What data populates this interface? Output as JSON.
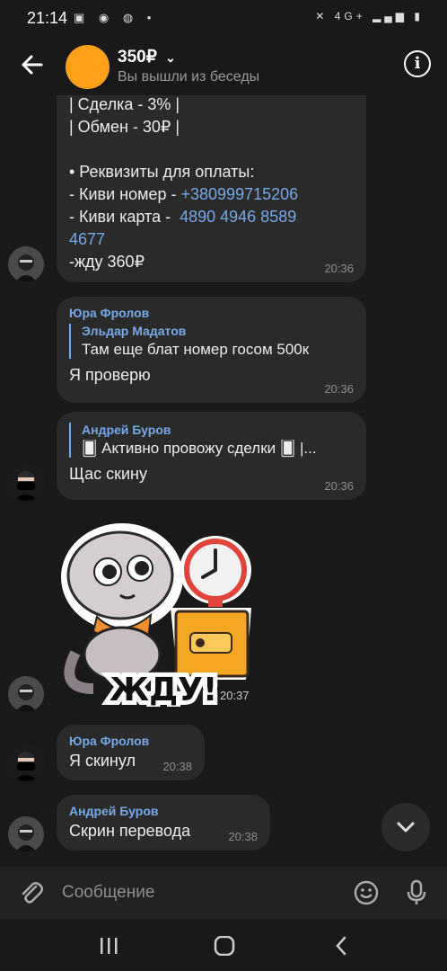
{
  "status_bar": {
    "time": "21:14",
    "network": "4G+"
  },
  "header": {
    "title": "350₽",
    "subtitle": "Вы вышли из беседы"
  },
  "messages": [
    {
      "lines": [
        "| Сделка - 3% |",
        "| Обмен - 30₽ |",
        "",
        "• Реквизиты для оплаты:",
        "- Киви номер - ",
        "- Киви карта -  ",
        "4677",
        "-жду 360₽"
      ],
      "phone": "+380999715206",
      "card": "4890 4946 8589",
      "time": "20:36"
    },
    {
      "sender": "Юра Фролов",
      "reply_name": "Эльдар Мадатов",
      "reply_text": "Там еще блат номер госом 500к",
      "text": "Я проверю",
      "time": "20:36"
    },
    {
      "reply_name": "Андрей Буров",
      "reply_text": "🂠 Активно провожу сделки 🂠 |...",
      "text": "Щас скину",
      "time": "20:36"
    },
    {
      "sticker_text": "ЖДУ!",
      "time": "20:37"
    },
    {
      "sender": "Юра Фролов",
      "text": "Я скинул",
      "time": "20:38"
    },
    {
      "sender": "Андрей Буров",
      "text": "Скрин перевода",
      "time": "20:38"
    }
  ],
  "composer": {
    "placeholder": "Сообщение"
  }
}
